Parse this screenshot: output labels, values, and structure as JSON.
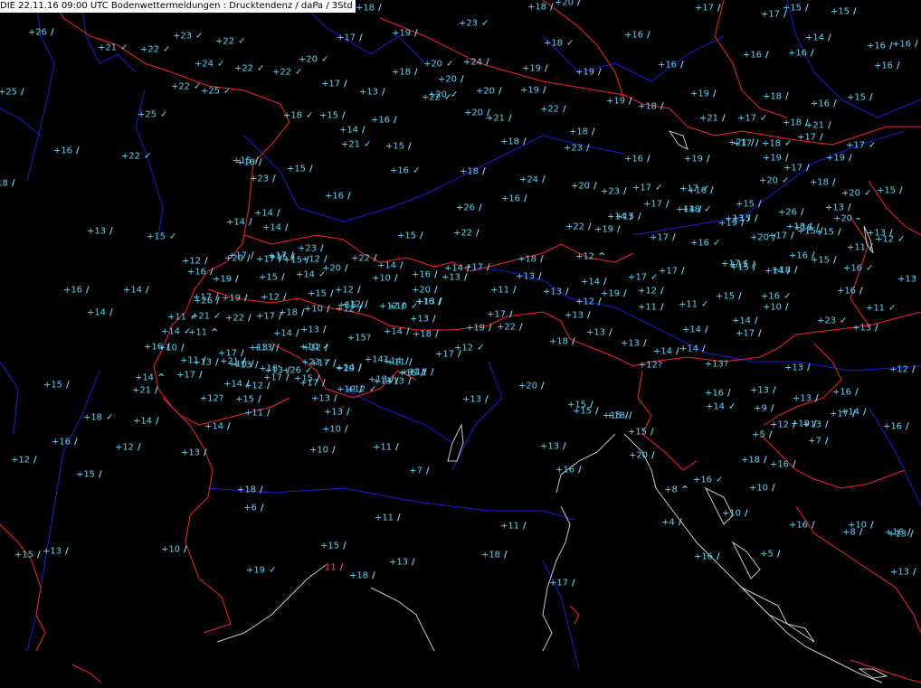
{
  "header": {
    "text": "DIE 22.11.16 09:00 UTC  Bodenwettermeldungen :  Drucktendenz / daPa / 3Std"
  },
  "colors": {
    "background": "#000000",
    "value": "#5ad4f5",
    "border": "#ff2020",
    "river": "#1a1ae0",
    "coast": "#c8c8c8",
    "negative": "#ff4a4a"
  },
  "icons": {
    "rising_steady": "tendency-rising-steady-icon",
    "rising": "tendency-rising-icon",
    "rising_then_falling": "tendency-rising-then-falling-icon",
    "missing": "tendency-unknown-icon"
  },
  "stations": [
    {
      "v": "+18",
      "s": "r"
    },
    {
      "v": "+18",
      "s": "r"
    },
    {
      "v": "+20",
      "s": "r"
    },
    {
      "v": "+17",
      "s": "r"
    },
    {
      "v": "+17",
      "s": "r"
    },
    {
      "v": "+15",
      "s": "r"
    },
    {
      "v": "+15",
      "s": "r"
    },
    {
      "v": "+26",
      "s": "r"
    },
    {
      "v": "+23",
      "s": "c"
    },
    {
      "v": "+19",
      "s": "r"
    },
    {
      "v": "+23",
      "s": "c"
    },
    {
      "v": "+16",
      "s": "r"
    },
    {
      "v": "+14",
      "s": "r"
    },
    {
      "v": "+16",
      "s": "r"
    },
    {
      "v": "+16",
      "s": "r"
    },
    {
      "v": "+21",
      "s": "c"
    },
    {
      "v": "+22",
      "s": "c"
    },
    {
      "v": "+22",
      "s": "c"
    },
    {
      "v": "+17",
      "s": "r"
    },
    {
      "v": "+20",
      "s": "c"
    },
    {
      "v": "+18",
      "s": "c"
    },
    {
      "v": "+16",
      "s": "r"
    },
    {
      "v": "+16",
      "s": "r"
    },
    {
      "v": "+24",
      "s": "c"
    },
    {
      "v": "+22",
      "s": "c"
    },
    {
      "v": "+22",
      "s": "c"
    },
    {
      "v": "+20",
      "s": "c"
    },
    {
      "v": "+24",
      "s": "r"
    },
    {
      "v": "+18",
      "s": "r"
    },
    {
      "v": "+20",
      "s": "r"
    },
    {
      "v": "+19",
      "s": "r"
    },
    {
      "v": "+19",
      "s": "r"
    },
    {
      "v": "+16",
      "s": "r"
    },
    {
      "v": "+16",
      "s": "r"
    },
    {
      "v": "+22",
      "s": "c"
    },
    {
      "v": "+25",
      "s": "c"
    },
    {
      "v": "+17",
      "s": "r"
    },
    {
      "v": "+13",
      "s": "r"
    },
    {
      "v": "+20",
      "s": "c"
    },
    {
      "v": "+20",
      "s": "r"
    },
    {
      "v": "+22",
      "s": "c"
    },
    {
      "v": "+19",
      "s": "r"
    },
    {
      "v": "+19",
      "s": "r"
    },
    {
      "v": "+18",
      "s": "r"
    },
    {
      "v": "+18",
      "s": "r"
    },
    {
      "v": "+16",
      "s": "r"
    },
    {
      "v": "+15",
      "s": "r"
    },
    {
      "v": "+25",
      "s": "r"
    },
    {
      "v": "+25",
      "s": "c"
    },
    {
      "v": "+18",
      "s": "c"
    },
    {
      "v": "+15",
      "s": "r"
    },
    {
      "v": "+16",
      "s": "r"
    },
    {
      "v": "+20",
      "s": "r"
    },
    {
      "v": "+21",
      "s": "r"
    },
    {
      "v": "+22",
      "s": "r"
    },
    {
      "v": "+19",
      "s": "r"
    },
    {
      "v": "+17",
      "s": "c"
    },
    {
      "v": "+18",
      "s": "r"
    },
    {
      "v": "+15",
      "s": "r"
    },
    {
      "v": "+14",
      "s": "r"
    },
    {
      "v": "+18",
      "s": "r"
    },
    {
      "v": "+21",
      "s": "r"
    },
    {
      "v": "+21",
      "s": "r"
    },
    {
      "v": "+17",
      "s": "r"
    },
    {
      "v": "+17",
      "s": "r"
    },
    {
      "v": "+16",
      "s": "r"
    },
    {
      "v": "+22",
      "s": "c"
    },
    {
      "v": "+21",
      "s": "c"
    },
    {
      "v": "+15",
      "s": "r"
    },
    {
      "v": "+23",
      "s": "r"
    },
    {
      "v": "+21",
      "s": "r"
    },
    {
      "v": "+18",
      "s": "c"
    },
    {
      "v": "+17",
      "s": "c"
    },
    {
      "v": "+18",
      "s": "r"
    },
    {
      "v": "+15",
      "s": "r"
    },
    {
      "v": "+16",
      "s": "c"
    },
    {
      "v": "+16",
      "s": "r"
    },
    {
      "v": "+19",
      "s": "r"
    },
    {
      "v": "+19",
      "s": "r"
    },
    {
      "v": "+17",
      "s": "r"
    },
    {
      "v": "+19",
      "s": "r"
    },
    {
      "v": "+18",
      "s": "r"
    },
    {
      "v": "+23",
      "s": "r"
    },
    {
      "v": "+16",
      "s": "r"
    },
    {
      "v": "+18",
      "s": "r"
    },
    {
      "v": "+24",
      "s": "r"
    },
    {
      "v": "+20",
      "s": "r"
    },
    {
      "v": "+16",
      "s": "r"
    },
    {
      "v": "+17",
      "s": "c"
    },
    {
      "v": "+20",
      "s": "c"
    },
    {
      "v": "+18",
      "s": "r"
    },
    {
      "v": "+20",
      "s": "c"
    },
    {
      "v": "+15",
      "s": "r"
    },
    {
      "v": "+18",
      "s": "r"
    },
    {
      "v": "+16",
      "s": "r"
    },
    {
      "v": "+26",
      "s": "r"
    },
    {
      "v": "+23",
      "s": "r"
    },
    {
      "v": "+17",
      "s": "c"
    },
    {
      "v": "+18",
      "s": "c"
    },
    {
      "v": "+17",
      "s": "r"
    },
    {
      "v": "+14",
      "s": "r"
    },
    {
      "v": "+15",
      "s": "r"
    },
    {
      "v": "+14",
      "s": "r"
    },
    {
      "v": "+14",
      "s": "r"
    },
    {
      "v": "+14",
      "s": "r"
    },
    {
      "v": "+15",
      "s": "c"
    },
    {
      "v": "+15",
      "s": "r"
    },
    {
      "v": "+22",
      "s": "r"
    },
    {
      "v": "+22",
      "s": "r"
    },
    {
      "v": "+19",
      "s": "r"
    },
    {
      "v": "+15",
      "s": "r"
    },
    {
      "v": "+17",
      "s": "r"
    },
    {
      "v": "+16",
      "s": "c"
    },
    {
      "v": "+13",
      "s": "r"
    },
    {
      "v": "+18",
      "s": "r"
    },
    {
      "v": "+26",
      "s": "r"
    },
    {
      "v": "+20",
      "s": "-"
    },
    {
      "v": "+11",
      "s": "r"
    },
    {
      "v": "+13",
      "s": "r"
    },
    {
      "v": "+14",
      "s": "r"
    },
    {
      "v": "+15",
      "s": "r"
    },
    {
      "v": "+12",
      "s": "c"
    },
    {
      "v": "+13",
      "s": "r"
    },
    {
      "v": "+15",
      "s": "r"
    },
    {
      "v": "+17",
      "s": "r"
    },
    {
      "v": "+16",
      "s": "r"
    },
    {
      "v": "+19",
      "s": "r"
    },
    {
      "v": "+20",
      "s": "r"
    },
    {
      "v": "+16",
      "s": "r"
    },
    {
      "v": "+15",
      "s": "r"
    },
    {
      "v": "+17",
      "s": "r"
    },
    {
      "v": "+15",
      "s": "r"
    },
    {
      "v": "+18",
      "s": "r"
    },
    {
      "v": "+15",
      "s": "r"
    },
    {
      "v": "+13",
      "s": "r"
    },
    {
      "v": "+12",
      "s": "r"
    },
    {
      "v": "+20",
      "s": "r"
    },
    {
      "v": "+17",
      "s": "r"
    },
    {
      "v": "+15",
      "s": "r"
    },
    {
      "v": "+12",
      "s": "r"
    },
    {
      "v": "+17",
      "s": "r"
    },
    {
      "v": "+15",
      "s": "r"
    },
    {
      "v": "+17",
      "s": "r"
    },
    {
      "v": "+23",
      "s": "r"
    },
    {
      "v": "+22",
      "s": "r"
    },
    {
      "v": "+14",
      "s": "r"
    },
    {
      "v": "+16",
      "s": "r"
    },
    {
      "v": "+14",
      "s": "r"
    },
    {
      "v": "+17",
      "s": "r"
    },
    {
      "v": "+18",
      "s": "r"
    },
    {
      "v": "+12",
      "s": "a"
    },
    {
      "v": "+16",
      "s": "r"
    },
    {
      "v": "+19",
      "s": "r"
    },
    {
      "v": "+15",
      "s": "r"
    },
    {
      "v": "+14",
      "s": "c"
    },
    {
      "v": "+20",
      "s": "r"
    },
    {
      "v": "+10",
      "s": "r"
    },
    {
      "v": "+13",
      "s": "r"
    },
    {
      "v": "+13",
      "s": "r"
    },
    {
      "v": "+14",
      "s": "r"
    },
    {
      "v": "+17",
      "s": "c"
    },
    {
      "v": "+17",
      "s": "r"
    },
    {
      "v": "+14",
      "s": "r"
    },
    {
      "v": "+16",
      "s": "r"
    },
    {
      "v": "+14",
      "s": "r"
    },
    {
      "v": "+17",
      "s": "r"
    },
    {
      "v": "+19",
      "s": "r"
    },
    {
      "v": "+12",
      "s": "r"
    },
    {
      "v": "+15",
      "s": "r"
    },
    {
      "v": "+12",
      "s": "r"
    },
    {
      "v": "+20",
      "s": "r"
    },
    {
      "v": "+11",
      "s": "r"
    },
    {
      "v": "+13",
      "s": "r"
    },
    {
      "v": "+19",
      "s": "r"
    },
    {
      "v": "+12",
      "s": "r"
    },
    {
      "v": "+15",
      "s": "r"
    },
    {
      "v": "+16",
      "s": "c"
    },
    {
      "v": "+16",
      "s": "r"
    },
    {
      "v": "+13",
      "s": "a"
    },
    {
      "v": "+26",
      "s": "r"
    },
    {
      "v": "+16",
      "s": "r"
    },
    {
      "v": "+12",
      "s": "r"
    },
    {
      "v": "+15",
      "s": "r"
    },
    {
      "v": "+12",
      "s": "r"
    },
    {
      "v": "+13",
      "s": "r"
    },
    {
      "v": "+10",
      "s": "c"
    },
    {
      "v": "+12",
      "s": "r"
    },
    {
      "v": "+11",
      "s": "r"
    },
    {
      "v": "+11",
      "s": "c"
    },
    {
      "v": "+15",
      "s": "r"
    },
    {
      "v": "+16",
      "s": "c"
    },
    {
      "v": "+14",
      "s": "r"
    },
    {
      "v": "+21",
      "s": "c"
    },
    {
      "v": "+22",
      "s": "r"
    },
    {
      "v": "+17",
      "s": "r"
    },
    {
      "v": "+18",
      "s": "r"
    },
    {
      "v": "+10",
      "s": "r"
    },
    {
      "v": "+12",
      "s": "r"
    },
    {
      "v": "+13",
      "s": "r"
    },
    {
      "v": "+17",
      "s": "r"
    },
    {
      "v": "+13",
      "s": "r"
    },
    {
      "v": "+10",
      "s": "r"
    },
    {
      "v": "+11",
      "s": "c"
    },
    {
      "v": "+11",
      "s": "c"
    },
    {
      "v": "+11",
      "s": "a"
    },
    {
      "v": "+14",
      "s": "r"
    },
    {
      "v": "+13",
      "s": "r"
    },
    {
      "v": "+15?",
      "s": ""
    },
    {
      "v": "+14",
      "s": "r"
    },
    {
      "v": "+18",
      "s": "r"
    },
    {
      "v": "+19",
      "s": "r"
    },
    {
      "v": "+22",
      "s": "r"
    },
    {
      "v": "+18",
      "s": "r"
    },
    {
      "v": "+13",
      "s": "r"
    },
    {
      "v": "+13",
      "s": "r"
    },
    {
      "v": "+14",
      "s": "r"
    },
    {
      "v": "+14",
      "s": "r"
    },
    {
      "v": "+17",
      "s": "r"
    },
    {
      "v": "+23",
      "s": "c"
    },
    {
      "v": "+13",
      "s": "r"
    },
    {
      "v": "+14",
      "s": "c"
    },
    {
      "v": "+10",
      "s": "r"
    },
    {
      "v": "+13",
      "s": "r"
    },
    {
      "v": "+10",
      "s": "c"
    },
    {
      "v": "+17",
      "s": "r"
    },
    {
      "v": "+12",
      "s": "c"
    },
    {
      "v": "+11",
      "s": "r"
    },
    {
      "v": "+11",
      "s": "r"
    },
    {
      "v": "+14",
      "s": "r"
    },
    {
      "v": "+16",
      "s": "r"
    },
    {
      "v": "+17",
      "s": "r"
    },
    {
      "v": "+13",
      "s": "r"
    },
    {
      "v": "+12",
      "s": "r"
    },
    {
      "v": "+10",
      "s": "r"
    },
    {
      "v": "+13",
      "s": "r"
    },
    {
      "v": "+14?",
      "s": ""
    },
    {
      "v": "+14",
      "s": "r"
    },
    {
      "v": "+13?",
      "s": ""
    },
    {
      "v": "+11",
      "s": "r"
    },
    {
      "v": "+21",
      "s": "r"
    },
    {
      "v": "+18'",
      "s": ""
    },
    {
      "v": "+26",
      "s": "c"
    },
    {
      "v": "+17",
      "s": "r"
    },
    {
      "v": "+14",
      "s": "r"
    },
    {
      "v": "+13",
      "s": "r"
    },
    {
      "v": "+15",
      "s": "r"
    },
    {
      "v": "+11",
      "s": "r"
    },
    {
      "v": "+15",
      "s": "r"
    },
    {
      "v": "+15",
      "s": "r"
    },
    {
      "v": "+13",
      "s": "r"
    },
    {
      "v": "+13",
      "s": "r"
    },
    {
      "v": "+17",
      "s": "r"
    },
    {
      "v": "+15",
      "s": "r"
    },
    {
      "v": "+23",
      "s": "c"
    },
    {
      "v": "+20",
      "s": "r"
    },
    {
      "v": "+12",
      "s": "c"
    },
    {
      "v": "+14",
      "s": "r"
    },
    {
      "v": "+12?",
      "s": ""
    },
    {
      "v": "+13",
      "s": "r"
    },
    {
      "v": "+12",
      "s": "r"
    },
    {
      "v": "+14",
      "s": "a"
    },
    {
      "v": "+21",
      "s": "r"
    },
    {
      "v": "+17",
      "s": "r"
    },
    {
      "v": "+14",
      "s": "r"
    },
    {
      "v": "+12",
      "s": "r"
    },
    {
      "v": "+17",
      "s": "r"
    },
    {
      "v": "+13",
      "s": "r"
    },
    {
      "v": "+10",
      "s": "r"
    },
    {
      "v": "+13",
      "s": "r"
    },
    {
      "v": "+13",
      "s": "r"
    },
    {
      "v": "+20",
      "s": "r"
    },
    {
      "v": "+16",
      "s": "r"
    },
    {
      "v": "+13",
      "s": "r"
    },
    {
      "v": "+14",
      "s": "c"
    },
    {
      "v": "+13",
      "s": "r"
    },
    {
      "v": "+16",
      "s": "r"
    },
    {
      "v": "+15",
      "s": "r"
    },
    {
      "v": "+12?",
      "s": ""
    },
    {
      "v": "+15",
      "s": "r"
    },
    {
      "v": "+13",
      "s": "r"
    },
    {
      "v": "+13",
      "s": "r"
    },
    {
      "v": "+9",
      "s": "r"
    },
    {
      "v": "+19",
      "s": "r"
    },
    {
      "v": "+17",
      "s": "r"
    },
    {
      "v": "+18",
      "s": "c"
    },
    {
      "v": "+14",
      "s": "r"
    },
    {
      "v": "+11",
      "s": "r"
    },
    {
      "v": "+10",
      "s": "r"
    },
    {
      "v": "+15",
      "s": "r"
    },
    {
      "v": "+18",
      "s": "r"
    },
    {
      "v": "+12",
      "s": "r"
    },
    {
      "v": "+13",
      "s": "r"
    },
    {
      "v": "+14",
      "s": "r"
    },
    {
      "v": "+16",
      "s": "r"
    },
    {
      "v": "+12",
      "s": "r"
    },
    {
      "v": "+13",
      "s": "r"
    },
    {
      "v": "+14",
      "s": "r"
    },
    {
      "v": "+13",
      "s": "r"
    },
    {
      "v": "+5",
      "s": "r"
    },
    {
      "v": "+15",
      "s": "r"
    },
    {
      "v": "+7",
      "s": "r"
    },
    {
      "v": "+16",
      "s": "r"
    },
    {
      "v": "+12",
      "s": "r"
    },
    {
      "v": "+15",
      "s": "r"
    },
    {
      "v": "+10",
      "s": "r"
    },
    {
      "v": "+11",
      "s": "r"
    },
    {
      "v": "+7",
      "s": "r"
    },
    {
      "v": "+16",
      "s": "r"
    },
    {
      "v": "+20",
      "s": "r"
    },
    {
      "v": "+18",
      "s": "r"
    },
    {
      "v": "+16",
      "s": "r"
    },
    {
      "v": "+18",
      "s": "r"
    },
    {
      "v": "+6",
      "s": "r"
    },
    {
      "v": "+8",
      "s": "a"
    },
    {
      "v": "+16",
      "s": "c"
    },
    {
      "v": "+10",
      "s": "r"
    },
    {
      "v": "+16",
      "s": "r"
    },
    {
      "v": "+10",
      "s": "r"
    },
    {
      "v": "+11",
      "s": "r"
    },
    {
      "v": "+11",
      "s": "r"
    },
    {
      "v": "+4",
      "s": "r"
    },
    {
      "v": "+10",
      "s": "r"
    },
    {
      "v": "+16",
      "s": "r"
    },
    {
      "v": "+15",
      "s": "r"
    },
    {
      "v": "+13",
      "s": "r"
    },
    {
      "v": "+10",
      "s": "r"
    },
    {
      "v": "+15",
      "s": "r"
    },
    {
      "v": "+18",
      "s": "r"
    },
    {
      "v": "+16",
      "s": "r"
    },
    {
      "v": "+5",
      "s": "r"
    },
    {
      "v": "+8",
      "s": "r"
    },
    {
      "v": "+13",
      "s": "r"
    },
    {
      "v": "+19",
      "s": "c"
    },
    {
      "v": "-11",
      "s": "neg"
    },
    {
      "v": "+18",
      "s": "r"
    },
    {
      "v": "+13",
      "s": "r"
    },
    {
      "v": "+17",
      "s": "r"
    },
    {
      "v": "+13",
      "s": "r"
    }
  ]
}
